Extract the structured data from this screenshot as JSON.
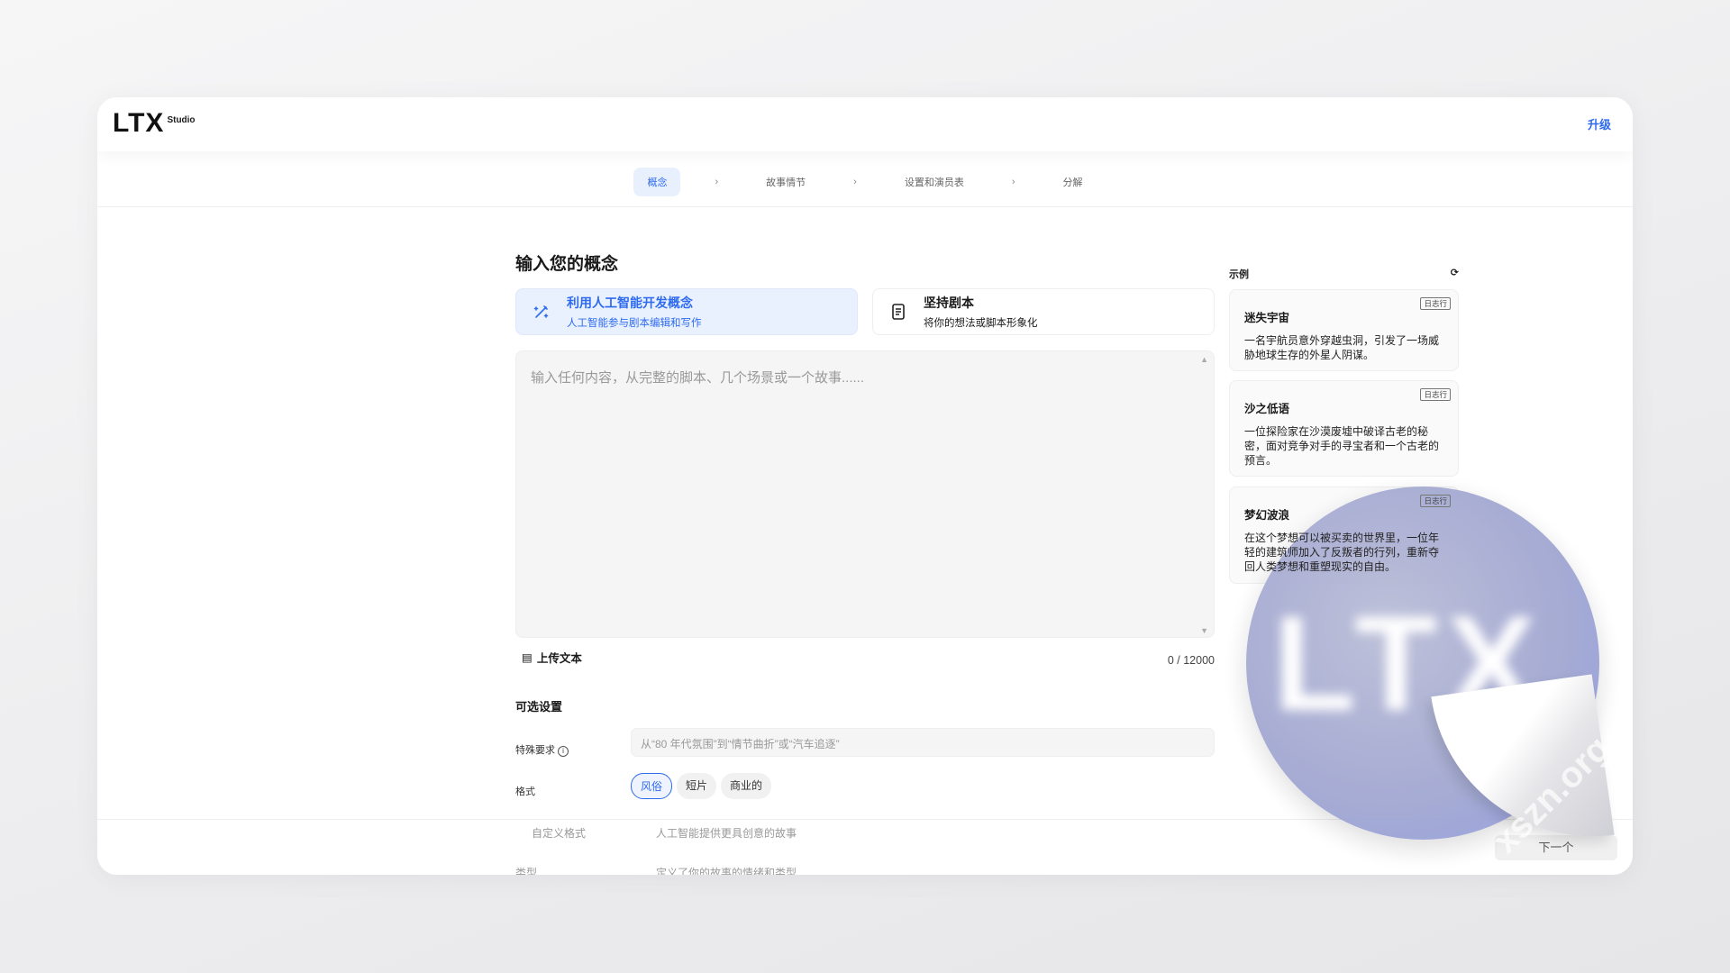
{
  "header": {
    "logo_main": "LTX",
    "logo_sub": "Studio",
    "upgrade": "升级"
  },
  "steps": [
    "概念",
    "故事情节",
    "设置和演员表",
    "分解"
  ],
  "main": {
    "title": "输入您的概念",
    "options": [
      {
        "title": "利用人工智能开发概念",
        "subtitle": "人工智能参与剧本编辑和写作"
      },
      {
        "title": "坚持剧本",
        "subtitle": "将你的想法或脚本形象化"
      }
    ],
    "textarea_placeholder": "输入任何内容，从完整的脚本、几个场景或一个故事......",
    "upload": "上传文本",
    "count": "0 / 12000",
    "optional": "可选设置",
    "special_label": "特殊要求",
    "special_placeholder": "从“80 年代氛围”到“情节曲折”或“汽车追逐”",
    "format_label": "格式",
    "formats": [
      "风俗",
      "短片",
      "商业的"
    ],
    "faded_label1": "自定义格式",
    "faded_ph1": "人工智能提供更具创意的故事",
    "faded_label2": "类型",
    "faded_ph2": "定义了你的故事的情绪和类型",
    "next": "下一个"
  },
  "examples": {
    "title": "示例",
    "items": [
      {
        "tag": "日志行",
        "name": "迷失宇宙",
        "desc": "一名宇航员意外穿越虫洞，引发了一场威胁地球生存的外星人阴谋。"
      },
      {
        "tag": "日志行",
        "name": "沙之低语",
        "desc": "一位探险家在沙漠废墟中破译古老的秘密，面对竞争对手的寻宝者和一个古老的预言。"
      },
      {
        "tag": "日志行",
        "name": "梦幻波浪",
        "desc": "在这个梦想可以被买卖的世界里，一位年轻的建筑师加入了反叛者的行列，重新夺回人类梦想和重塑现实的自由。"
      }
    ]
  },
  "watermark": {
    "sticker": "LTX",
    "site": "xszn.org"
  },
  "colors": {
    "accent": "#2f6bf0"
  }
}
